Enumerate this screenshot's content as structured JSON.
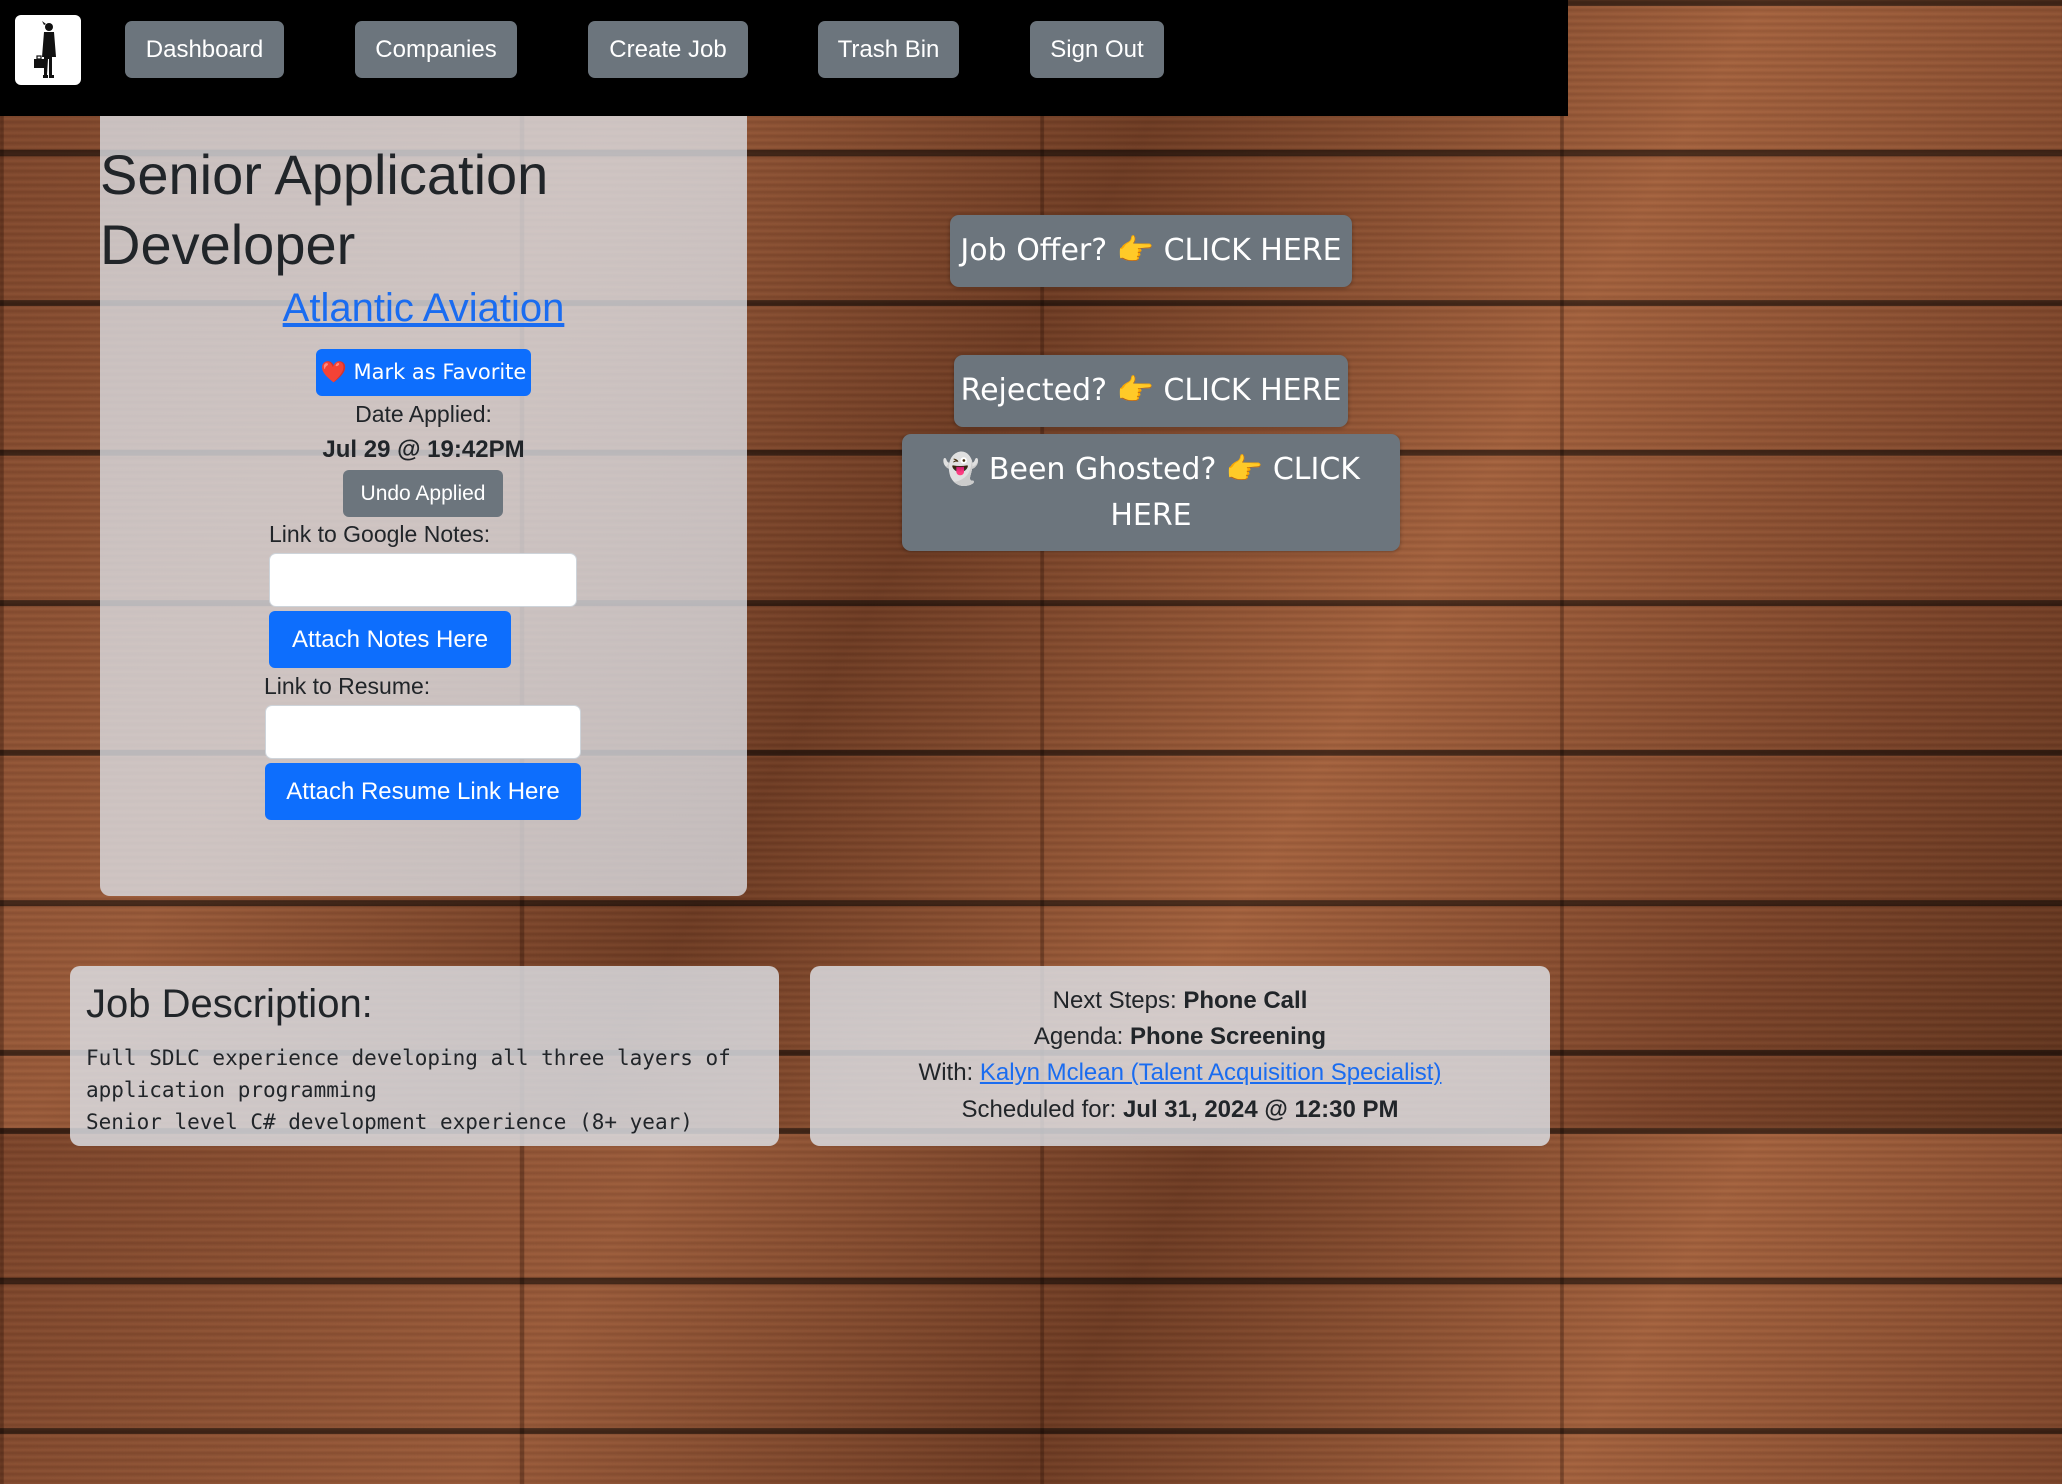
{
  "nav": {
    "items": [
      {
        "label": "Dashboard"
      },
      {
        "label": "Companies"
      },
      {
        "label": "Create Job"
      },
      {
        "label": "Trash Bin"
      },
      {
        "label": "Sign Out"
      }
    ]
  },
  "job": {
    "title": "Senior Application Developer",
    "company": "Atlantic Aviation",
    "favorite_label": "❤️ Mark as Favorite",
    "date_applied_label": "Date Applied:",
    "date_applied_value": "Jul 29 @ 19:42PM",
    "undo_label": "Undo Applied",
    "notes_label": "Link to Google Notes:",
    "notes_value": "",
    "attach_notes_label": "Attach Notes Here",
    "resume_label": "Link to Resume:",
    "resume_value": "",
    "attach_resume_label": "Attach Resume Link Here"
  },
  "status_actions": {
    "offer": "Job Offer? 👉 CLICK HERE",
    "rejected": "Rejected? 👉 CLICK HERE",
    "ghosted_line1": "👻 Been Ghosted? 👉 CLICK",
    "ghosted_line2": "HERE"
  },
  "description": {
    "heading": "Job Description:",
    "body": "Full SDLC experience developing all three layers of\napplication programming\nSenior level C# development experience (8+ year)"
  },
  "next_steps": {
    "steps_label": "Next Steps:",
    "steps_value": "Phone Call",
    "agenda_label": "Agenda:",
    "agenda_value": "Phone Screening",
    "with_label": "With:",
    "with_value": "Kalyn Mclean (Talent Acquisition Specialist)",
    "scheduled_label": "Scheduled for:",
    "scheduled_value": "Jul 31, 2024 @ 12:30 PM"
  },
  "colors": {
    "primary": "#0d6efd",
    "secondary": "#6c757d",
    "link": "#1a6cf0",
    "navbar": "#000000"
  },
  "icons": {
    "logo": "businessman-with-briefcase-icon"
  }
}
